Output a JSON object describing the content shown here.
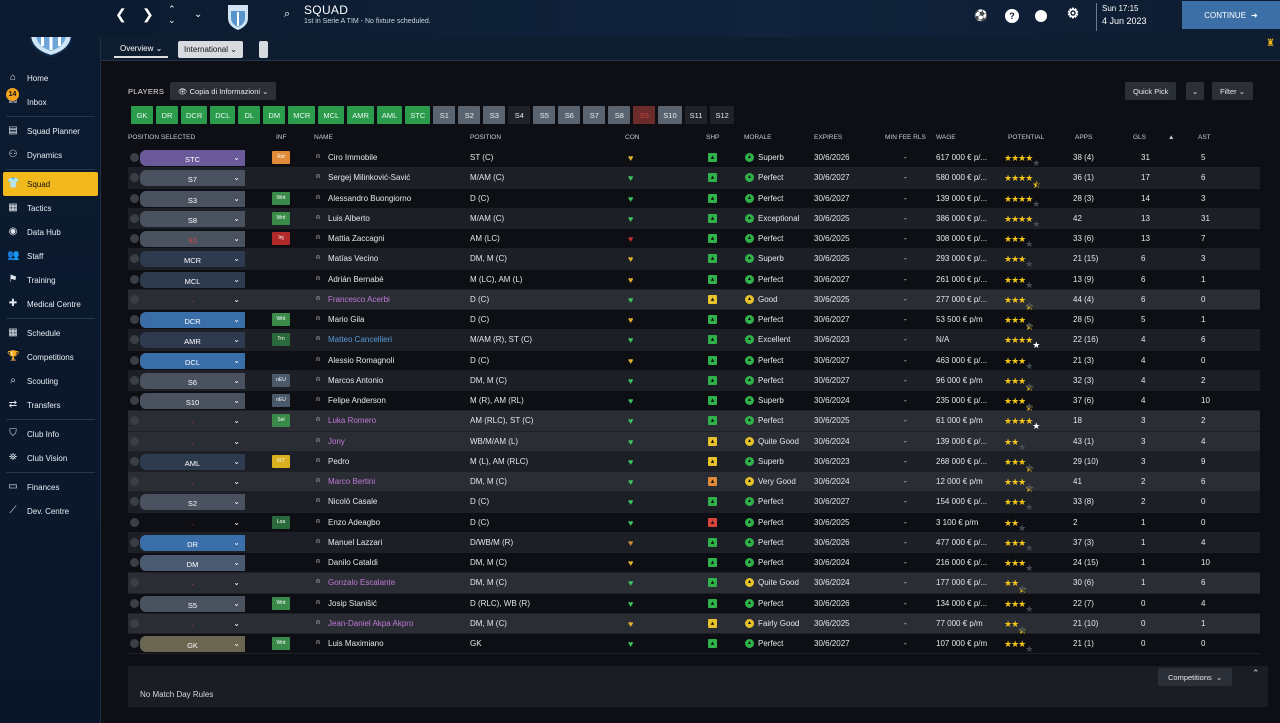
{
  "topbar": {
    "title": "SQUAD",
    "subtitle": "1st in Serie A TIM - No fixture scheduled.",
    "day_time": "Sun 17:15",
    "date": "4 Jun 2023",
    "continue_label": "CONTINUE"
  },
  "tabs": {
    "overview": "Overview",
    "international": "International"
  },
  "sidebar": {
    "items": [
      {
        "label": "Home",
        "icon": "home-icon"
      },
      {
        "label": "Inbox",
        "icon": "inbox-icon",
        "badge": "14"
      },
      {
        "label": "Squad Planner",
        "icon": "clipboard-icon"
      },
      {
        "label": "Dynamics",
        "icon": "dynamics-icon"
      },
      {
        "label": "Squad",
        "icon": "shirt-icon"
      },
      {
        "label": "Tactics",
        "icon": "tactics-icon"
      },
      {
        "label": "Data Hub",
        "icon": "data-icon"
      },
      {
        "label": "Staff",
        "icon": "staff-icon"
      },
      {
        "label": "Training",
        "icon": "training-icon"
      },
      {
        "label": "Medical Centre",
        "icon": "medical-icon"
      },
      {
        "label": "Schedule",
        "icon": "calendar-icon"
      },
      {
        "label": "Competitions",
        "icon": "trophy-icon"
      },
      {
        "label": "Scouting",
        "icon": "search-icon"
      },
      {
        "label": "Transfers",
        "icon": "transfer-icon"
      },
      {
        "label": "Club Info",
        "icon": "shield-icon"
      },
      {
        "label": "Club Vision",
        "icon": "vision-icon"
      },
      {
        "label": "Finances",
        "icon": "finance-icon"
      },
      {
        "label": "Dev. Centre",
        "icon": "dev-icon"
      }
    ]
  },
  "toolbar": {
    "players_label": "PLAYERS",
    "copy_label": "Copia di Informazioni",
    "quick_pick": "Quick Pick",
    "filter": "Filter",
    "competitions": "Competitions",
    "no_match": "No Match Day Rules"
  },
  "positions": [
    {
      "label": "GK",
      "state": "g"
    },
    {
      "label": "DR",
      "state": "g"
    },
    {
      "label": "DCR",
      "state": "g"
    },
    {
      "label": "DCL",
      "state": "g"
    },
    {
      "label": "DL",
      "state": "g"
    },
    {
      "label": "DM",
      "state": "g"
    },
    {
      "label": "MCR",
      "state": "g"
    },
    {
      "label": "MCL",
      "state": "g"
    },
    {
      "label": "AMR",
      "state": "g"
    },
    {
      "label": "AML",
      "state": "g"
    },
    {
      "label": "STC",
      "state": "g"
    },
    {
      "label": "S1",
      "state": "s"
    },
    {
      "label": "S2",
      "state": "s"
    },
    {
      "label": "S3",
      "state": "s"
    },
    {
      "label": "S4",
      "state": "d"
    },
    {
      "label": "S5",
      "state": "s"
    },
    {
      "label": "S6",
      "state": "s"
    },
    {
      "label": "S7",
      "state": "s"
    },
    {
      "label": "S8",
      "state": "s"
    },
    {
      "label": "S9",
      "state": "r"
    },
    {
      "label": "S10",
      "state": "s"
    },
    {
      "label": "S11",
      "state": "d"
    },
    {
      "label": "S12",
      "state": "d"
    }
  ],
  "headers": {
    "pos": "POSITION SELECTED",
    "inf": "INF",
    "name": "NAME",
    "position": "POSITION",
    "con": "CON",
    "shp": "SHP",
    "morale": "MORALE",
    "expires": "EXPIRES",
    "minfee": "MIN FEE RLS",
    "wage": "WAGE",
    "potential": "POTENTIAL",
    "apps": "APPS",
    "gls": "GLS",
    "ast": "AST"
  },
  "players": [
    {
      "sel": "STC",
      "selc": "#6a5a9a",
      "inf": "Rst",
      "infc": "#e08a3a",
      "name": "Ciro Immobile",
      "pos": "ST (C)",
      "con": "#e0b030",
      "shp": "g",
      "mor": "Superb",
      "morc": "g",
      "exp": "30/6/2026",
      "fee": "-",
      "wage": "617 000 € p/...",
      "stars": "4",
      "apps": "38 (4)",
      "gls": "31",
      "ast": "5",
      "nc": "#e5e7ea"
    },
    {
      "sel": "S7",
      "selc": "#4a5260",
      "inf": "",
      "infc": "",
      "name": "Sergej Milinković-Savić",
      "pos": "M/AM (C)",
      "con": "#3cc060",
      "shp": "g",
      "mor": "Perfect",
      "morc": "g",
      "exp": "30/6/2027",
      "fee": "-",
      "wage": "580 000 € p/...",
      "stars": "4.5",
      "apps": "36 (1)",
      "gls": "17",
      "ast": "6",
      "nc": "#e5e7ea"
    },
    {
      "sel": "S3",
      "selc": "#4a5260",
      "inf": "Wnt",
      "infc": "#3a8a4a",
      "name": "Alessandro Buongiorno",
      "pos": "D (C)",
      "con": "#3cc060",
      "shp": "g",
      "mor": "Perfect",
      "morc": "g",
      "exp": "30/6/2027",
      "fee": "-",
      "wage": "139 000 € p/...",
      "stars": "4",
      "apps": "28 (3)",
      "gls": "14",
      "ast": "3",
      "nc": "#e5e7ea"
    },
    {
      "sel": "S8",
      "selc": "#4a5260",
      "inf": "Wnt",
      "infc": "#3a8a4a",
      "name": "Luis Alberto",
      "pos": "M/AM (C)",
      "con": "#3cc060",
      "shp": "g",
      "mor": "Exceptional",
      "morc": "g",
      "exp": "30/6/2025",
      "fee": "-",
      "wage": "386 000 € p/...",
      "stars": "4",
      "apps": "42",
      "gls": "13",
      "ast": "31",
      "nc": "#e5e7ea"
    },
    {
      "sel": "S1",
      "selc": "#4a5260",
      "inf": "Inj",
      "infc": "#b02a2a",
      "name": "Mattia Zaccagni",
      "pos": "AM (LC)",
      "con": "#c03030",
      "shp": "g",
      "mor": "Perfect",
      "morc": "g",
      "exp": "30/6/2025",
      "fee": "-",
      "wage": "308 000 € p/...",
      "stars": "3",
      "apps": "33 (6)",
      "gls": "13",
      "ast": "7",
      "nc": "#e5e7ea",
      "selred": true
    },
    {
      "sel": "MCR",
      "selc": "#2e3a4e",
      "inf": "",
      "infc": "",
      "name": "Matías Vecino",
      "pos": "DM, M (C)",
      "con": "#e0b030",
      "shp": "g",
      "mor": "Superb",
      "morc": "g",
      "exp": "30/6/2025",
      "fee": "-",
      "wage": "293 000 € p/...",
      "stars": "3",
      "apps": "21 (15)",
      "gls": "6",
      "ast": "3",
      "nc": "#e5e7ea"
    },
    {
      "sel": "MCL",
      "selc": "#2e3a4e",
      "inf": "",
      "infc": "",
      "name": "Adrián Bernabé",
      "pos": "M (LC), AM (L)",
      "con": "#e0b030",
      "shp": "g",
      "mor": "Perfect",
      "morc": "g",
      "exp": "30/6/2027",
      "fee": "-",
      "wage": "261 000 € p/...",
      "stars": "3",
      "apps": "13 (9)",
      "gls": "6",
      "ast": "1",
      "nc": "#e5e7ea"
    },
    {
      "sel": "-",
      "selc": "transparent",
      "inf": "",
      "infc": "",
      "name": "Francesco Acerbi",
      "pos": "D (C)",
      "con": "#3cc060",
      "shp": "y",
      "mor": "Good",
      "morc": "y",
      "exp": "30/6/2025",
      "fee": "-",
      "wage": "277 000 € p/...",
      "stars": "3.5",
      "apps": "44 (4)",
      "gls": "6",
      "ast": "0",
      "nc": "#c07ad8",
      "hl": true
    },
    {
      "sel": "DCR",
      "selc": "#3a6ea8",
      "inf": "Wnt",
      "infc": "#3a8a4a",
      "name": "Mario Gila",
      "pos": "D (C)",
      "con": "#e0b030",
      "shp": "g",
      "mor": "Perfect",
      "morc": "g",
      "exp": "30/6/2027",
      "fee": "-",
      "wage": "53 500 € p/m",
      "stars": "3.5",
      "apps": "28 (5)",
      "gls": "5",
      "ast": "1",
      "nc": "#e5e7ea"
    },
    {
      "sel": "AMR",
      "selc": "#2e3a4e",
      "inf": "Trn",
      "infc": "#2a6a3a",
      "name": "Matteo Cancellieri",
      "pos": "M/AM (R), ST (C)",
      "con": "#3cc060",
      "shp": "g",
      "mor": "Excellent",
      "morc": "g",
      "exp": "30/6/2023",
      "fee": "-",
      "wage": "N/A",
      "stars": "5w",
      "apps": "22 (16)",
      "gls": "4",
      "ast": "6",
      "nc": "#5a9ad8"
    },
    {
      "sel": "DCL",
      "selc": "#3a6ea8",
      "inf": "",
      "infc": "",
      "name": "Alessio Romagnoli",
      "pos": "D (C)",
      "con": "#e0b030",
      "shp": "g",
      "mor": "Perfect",
      "morc": "g",
      "exp": "30/6/2027",
      "fee": "-",
      "wage": "463 000 € p/...",
      "stars": "3",
      "apps": "21 (3)",
      "gls": "4",
      "ast": "0",
      "nc": "#e5e7ea"
    },
    {
      "sel": "S6",
      "selc": "#4a5260",
      "inf": "nEU",
      "infc": "#4a5a6a",
      "name": "Marcos Antonio",
      "pos": "DM, M (C)",
      "con": "#3cc060",
      "shp": "g",
      "mor": "Perfect",
      "morc": "g",
      "exp": "30/6/2027",
      "fee": "-",
      "wage": "96 000 € p/m",
      "stars": "3.5",
      "apps": "32 (3)",
      "gls": "4",
      "ast": "2",
      "nc": "#e5e7ea"
    },
    {
      "sel": "S10",
      "selc": "#4a5260",
      "inf": "nEU",
      "infc": "#4a5a6a",
      "name": "Felipe Anderson",
      "pos": "M (R), AM (RL)",
      "con": "#3cc060",
      "shp": "g",
      "mor": "Superb",
      "morc": "g",
      "exp": "30/6/2024",
      "fee": "-",
      "wage": "235 000 € p/...",
      "stars": "3.5",
      "apps": "37 (6)",
      "gls": "4",
      "ast": "10",
      "nc": "#e5e7ea"
    },
    {
      "sel": "-",
      "selc": "transparent",
      "inf": "Sel",
      "infc": "#3a8a4a",
      "name": "Luka Romero",
      "pos": "AM (RLC), ST (C)",
      "con": "#3cc060",
      "shp": "g",
      "mor": "Perfect",
      "morc": "g",
      "exp": "30/6/2025",
      "fee": "-",
      "wage": "61 000 € p/m",
      "stars": "5w",
      "apps": "18",
      "gls": "3",
      "ast": "2",
      "nc": "#c07ad8",
      "hl": true
    },
    {
      "sel": "-",
      "selc": "transparent",
      "inf": "",
      "infc": "",
      "name": "Jony",
      "pos": "WB/M/AM (L)",
      "con": "#3cc060",
      "shp": "y",
      "mor": "Quite Good",
      "morc": "y",
      "exp": "30/6/2024",
      "fee": "-",
      "wage": "139 000 € p/...",
      "stars": "2",
      "apps": "43 (1)",
      "gls": "3",
      "ast": "4",
      "nc": "#c07ad8",
      "hl": true
    },
    {
      "sel": "AML",
      "selc": "#2e3a4e",
      "inf": "FIT",
      "infc": "#d8b020",
      "name": "Pedro",
      "pos": "M (L), AM (RLC)",
      "con": "#3cc060",
      "shp": "y",
      "mor": "Superb",
      "morc": "g",
      "exp": "30/6/2023",
      "fee": "-",
      "wage": "268 000 € p/...",
      "stars": "3.5",
      "apps": "29 (10)",
      "gls": "3",
      "ast": "9",
      "nc": "#e5e7ea"
    },
    {
      "sel": "-",
      "selc": "transparent",
      "inf": "",
      "infc": "",
      "name": "Marco Bertini",
      "pos": "DM, M (C)",
      "con": "#3cc060",
      "shp": "o",
      "mor": "Very Good",
      "morc": "y",
      "exp": "30/6/2024",
      "fee": "-",
      "wage": "12 000 € p/m",
      "stars": "3.5",
      "apps": "41",
      "gls": "2",
      "ast": "6",
      "nc": "#c07ad8",
      "hl": true
    },
    {
      "sel": "S2",
      "selc": "#4a5260",
      "inf": "",
      "infc": "",
      "name": "Nicolò Casale",
      "pos": "D (C)",
      "con": "#3cc060",
      "shp": "g",
      "mor": "Perfect",
      "morc": "g",
      "exp": "30/6/2027",
      "fee": "-",
      "wage": "154 000 € p/...",
      "stars": "3",
      "apps": "33 (8)",
      "gls": "2",
      "ast": "0",
      "nc": "#e5e7ea"
    },
    {
      "sel": "-",
      "selc": "transparent",
      "inf": "Loa",
      "infc": "#2a6a3a",
      "name": "Enzo Adeagbo",
      "pos": "D (C)",
      "con": "#3cc060",
      "shp": "r",
      "mor": "Perfect",
      "morc": "g",
      "exp": "30/6/2025",
      "fee": "-",
      "wage": "3 100 € p/m",
      "stars": "2",
      "apps": "2",
      "gls": "1",
      "ast": "0",
      "nc": "#e5e7ea"
    },
    {
      "sel": "DR",
      "selc": "#3a6ea8",
      "inf": "",
      "infc": "",
      "name": "Manuel Lazzari",
      "pos": "D/WB/M (R)",
      "con": "#c08a30",
      "shp": "g",
      "mor": "Perfect",
      "morc": "g",
      "exp": "30/6/2026",
      "fee": "-",
      "wage": "477 000 € p/...",
      "stars": "3",
      "apps": "37 (3)",
      "gls": "1",
      "ast": "4",
      "nc": "#e5e7ea"
    },
    {
      "sel": "DM",
      "selc": "#4a5a70",
      "inf": "",
      "infc": "",
      "name": "Danilo Cataldi",
      "pos": "DM, M (C)",
      "con": "#e0b030",
      "shp": "g",
      "mor": "Perfect",
      "morc": "g",
      "exp": "30/6/2024",
      "fee": "-",
      "wage": "216 000 € p/...",
      "stars": "3",
      "apps": "24 (15)",
      "gls": "1",
      "ast": "10",
      "nc": "#e5e7ea"
    },
    {
      "sel": "-",
      "selc": "transparent",
      "inf": "",
      "infc": "",
      "name": "Gonzalo Escalante",
      "pos": "DM, M (C)",
      "con": "#3cc060",
      "shp": "g",
      "mor": "Quite Good",
      "morc": "y",
      "exp": "30/6/2024",
      "fee": "-",
      "wage": "177 000 € p/...",
      "stars": "2.5",
      "apps": "30 (6)",
      "gls": "1",
      "ast": "6",
      "nc": "#c07ad8",
      "hl": true
    },
    {
      "sel": "S5",
      "selc": "#4a5260",
      "inf": "Wnt",
      "infc": "#3a8a4a",
      "name": "Josip Stanišić",
      "pos": "D (RLC), WB (R)",
      "con": "#3cc060",
      "shp": "g",
      "mor": "Perfect",
      "morc": "g",
      "exp": "30/6/2026",
      "fee": "-",
      "wage": "134 000 € p/...",
      "stars": "3",
      "apps": "22 (7)",
      "gls": "0",
      "ast": "4",
      "nc": "#e5e7ea"
    },
    {
      "sel": "-",
      "selc": "transparent",
      "inf": "",
      "infc": "",
      "name": "Jean-Daniel Akpa Akpro",
      "pos": "DM, M (C)",
      "con": "#e0b030",
      "shp": "y",
      "mor": "Fairly Good",
      "morc": "y",
      "exp": "30/6/2025",
      "fee": "-",
      "wage": "77 000 € p/m",
      "stars": "2.5",
      "apps": "21 (10)",
      "gls": "0",
      "ast": "1",
      "nc": "#c07ad8",
      "hl": true
    },
    {
      "sel": "GK",
      "selc": "#6a6650",
      "inf": "Wnt",
      "infc": "#3a8a4a",
      "name": "Luis Maximiano",
      "pos": "GK",
      "con": "#3cc060",
      "shp": "g",
      "mor": "Perfect",
      "morc": "g",
      "exp": "30/6/2027",
      "fee": "-",
      "wage": "107 000 € p/m",
      "stars": "3",
      "apps": "21 (1)",
      "gls": "0",
      "ast": "0",
      "nc": "#e5e7ea"
    }
  ]
}
